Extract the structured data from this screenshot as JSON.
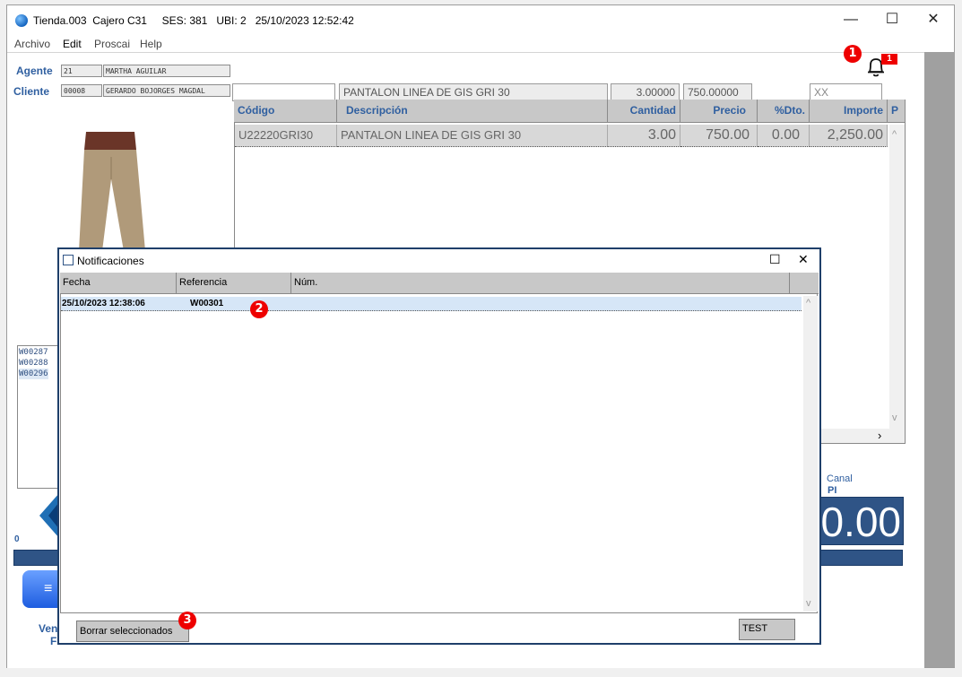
{
  "window": {
    "title": "Tienda.003  Cajero C31     SES: 381   UBI: 2   25/10/2023 12:52:42",
    "minimize": "—",
    "maximize": "☐",
    "close": "✕"
  },
  "menu": [
    "Archivo",
    "Edit",
    "Proscai",
    "Help"
  ],
  "agent": {
    "label": "Agente",
    "code": "21",
    "name": "MARTHA AGUILAR"
  },
  "client": {
    "label": "Cliente",
    "code": "00008",
    "name": "GERARDO BOJORGES MAGDAL"
  },
  "entry": {
    "code": "",
    "description": "PANTALON LINEA DE GIS GRI 30",
    "quantity": "3.00000",
    "price": "750.00000",
    "extra": "XX"
  },
  "grid": {
    "headers": [
      "Código",
      "Descripción",
      "Cantidad",
      "Precio",
      "%Dto.",
      "Importe",
      "P"
    ],
    "rows": [
      [
        "U22220GRI30",
        "PANTALON LINEA DE GIS GRI 30",
        "3.00",
        "750.00",
        "0.00",
        "2,250.00"
      ]
    ]
  },
  "notifications_badge": "1",
  "left_list": [
    "W00287",
    "W00288",
    "W00296"
  ],
  "left_bottom": {
    "zero": "0",
    "ven": "Ven",
    "f": "F"
  },
  "canal": {
    "label": "Canal",
    "value": "PI"
  },
  "total": "0.00",
  "notif": {
    "title": "Notificaciones",
    "maximize": "☐",
    "close": "✕",
    "headers": [
      "Fecha",
      "Referencia",
      "Núm."
    ],
    "rows": [
      [
        "25/10/2023 12:38:06",
        "W00301",
        ""
      ]
    ],
    "delete_button": "Borrar seleccionados",
    "test_button": "TEST"
  },
  "callouts": [
    "1",
    "2",
    "3"
  ],
  "colors": {
    "accent": "#2f5fa0",
    "callout": "#e00000",
    "total_bg": "#2f5486"
  }
}
